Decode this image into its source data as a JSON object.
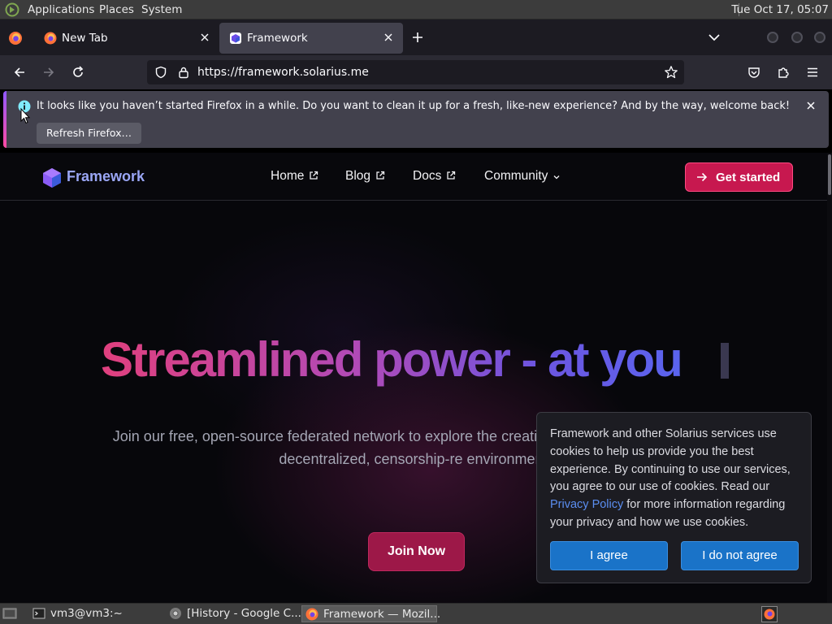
{
  "top_panel": {
    "menus": [
      "Applications",
      "Places",
      "System"
    ],
    "clock": "Tue Oct 17, 05:07"
  },
  "browser": {
    "tabs": [
      {
        "title": "New Tab",
        "active": false
      },
      {
        "title": "Framework",
        "active": true
      }
    ],
    "url": "https://framework.solarius.me",
    "notification": {
      "message": "It looks like you haven’t started Firefox in a while. Do you want to clean it up for a fresh, like-new experience? And by the way, welcome back!",
      "button": "Refresh Firefox…"
    }
  },
  "site": {
    "name": "Framework",
    "nav": [
      "Home",
      "Blog",
      "Docs",
      "Community"
    ],
    "cta": "Get started",
    "hero_title": "Streamlined power - at you",
    "hero_subtitle": "Join our free, open-source federated network to explore the creativity and self-expression in a decentralized, censorship-re environment.",
    "join_button": "Join Now",
    "cookie": {
      "text_before": "Framework and other Solarius services use cookies to help us provide you the best experience. By continuing to use our services, you agree to our use of cookies. Read our ",
      "link": "Privacy Policy",
      "text_after": " for more information regarding your privacy and how we use cookies.",
      "agree": "I agree",
      "disagree": "I do not agree"
    }
  },
  "taskbar": {
    "items": [
      "vm3@vm3:~",
      "[History - Google C...",
      "Framework — Mozil..."
    ]
  },
  "colors": {
    "accent_pink": "#c7184f",
    "cookie_button_blue": "#1a73c8",
    "link_blue": "#5b8ef0"
  }
}
